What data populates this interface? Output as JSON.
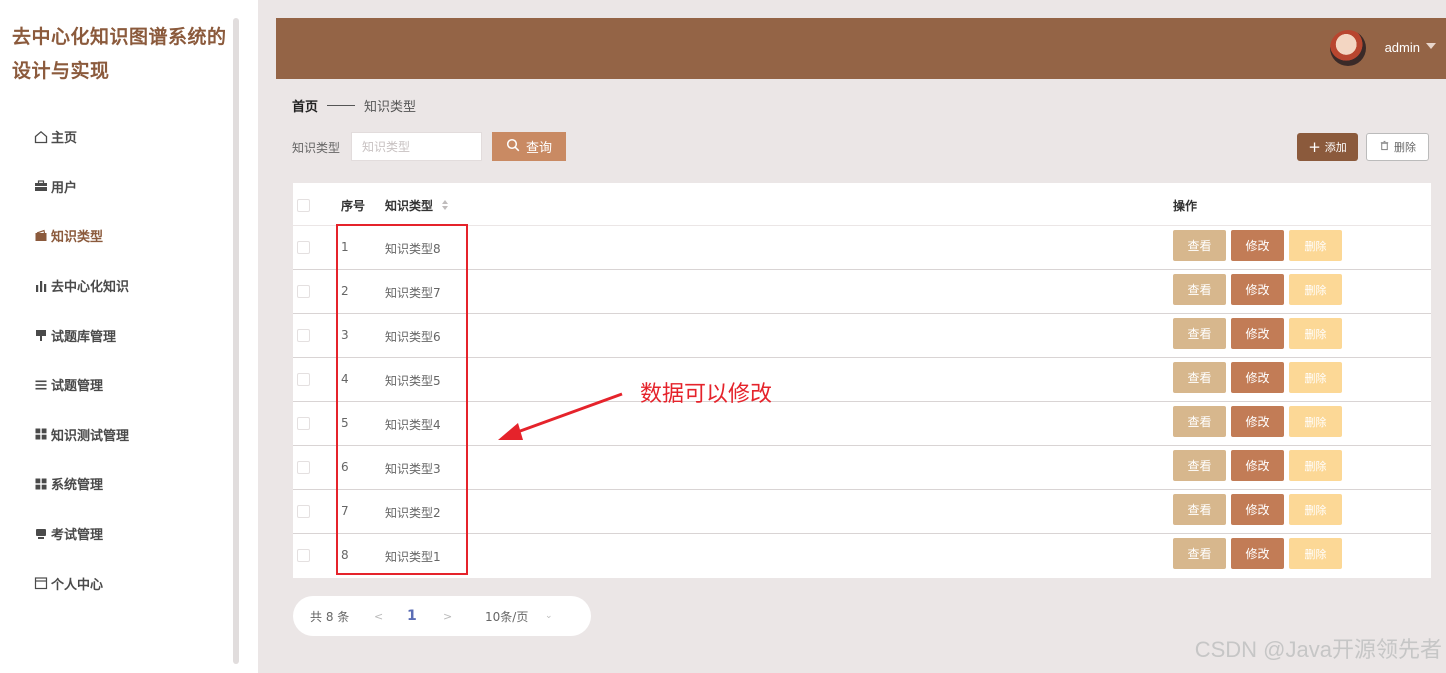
{
  "app": {
    "title": "去中心化知识图谱系统的设计与实现"
  },
  "sidebar": {
    "items": [
      {
        "label": "主页",
        "icon": "home-icon",
        "active": false
      },
      {
        "label": "用户",
        "icon": "briefcase-icon",
        "active": false
      },
      {
        "label": "知识类型",
        "icon": "wallet-icon",
        "active": true
      },
      {
        "label": "去中心化知识",
        "icon": "bar-chart-icon",
        "active": false
      },
      {
        "label": "试题库管理",
        "icon": "pushpin-icon",
        "active": false
      },
      {
        "label": "试题管理",
        "icon": "list-icon",
        "active": false
      },
      {
        "label": "知识测试管理",
        "icon": "grid-icon",
        "active": false
      },
      {
        "label": "系统管理",
        "icon": "grid-icon",
        "active": false
      },
      {
        "label": "考试管理",
        "icon": "monitor-icon",
        "active": false
      },
      {
        "label": "个人中心",
        "icon": "calendar-icon",
        "active": false
      }
    ]
  },
  "header": {
    "username": "admin"
  },
  "breadcrumb": {
    "home": "首页",
    "current": "知识类型"
  },
  "search": {
    "label": "知识类型",
    "placeholder": "知识类型",
    "button": "查询"
  },
  "toolbar": {
    "add": "添加",
    "delete": "删除"
  },
  "table": {
    "columns": {
      "index": "序号",
      "type": "知识类型",
      "actions": "操作"
    },
    "rows": [
      {
        "index": "1",
        "type": "知识类型8"
      },
      {
        "index": "2",
        "type": "知识类型7"
      },
      {
        "index": "3",
        "type": "知识类型6"
      },
      {
        "index": "4",
        "type": "知识类型5"
      },
      {
        "index": "5",
        "type": "知识类型4"
      },
      {
        "index": "6",
        "type": "知识类型3"
      },
      {
        "index": "7",
        "type": "知识类型2"
      },
      {
        "index": "8",
        "type": "知识类型1"
      }
    ],
    "actions": {
      "view": "查看",
      "edit": "修改",
      "delete": "删除"
    }
  },
  "annotation": {
    "text": "数据可以修改"
  },
  "pagination": {
    "total": "共 8 条",
    "prev": "<",
    "page": "1",
    "next": ">",
    "size": "10条/页"
  },
  "watermark": "CSDN @Java开源领先者",
  "colors": {
    "brand": "#946446",
    "accent": "#c98a63",
    "active_menu": "#8b5a3c",
    "annotation": "#e5232b"
  }
}
